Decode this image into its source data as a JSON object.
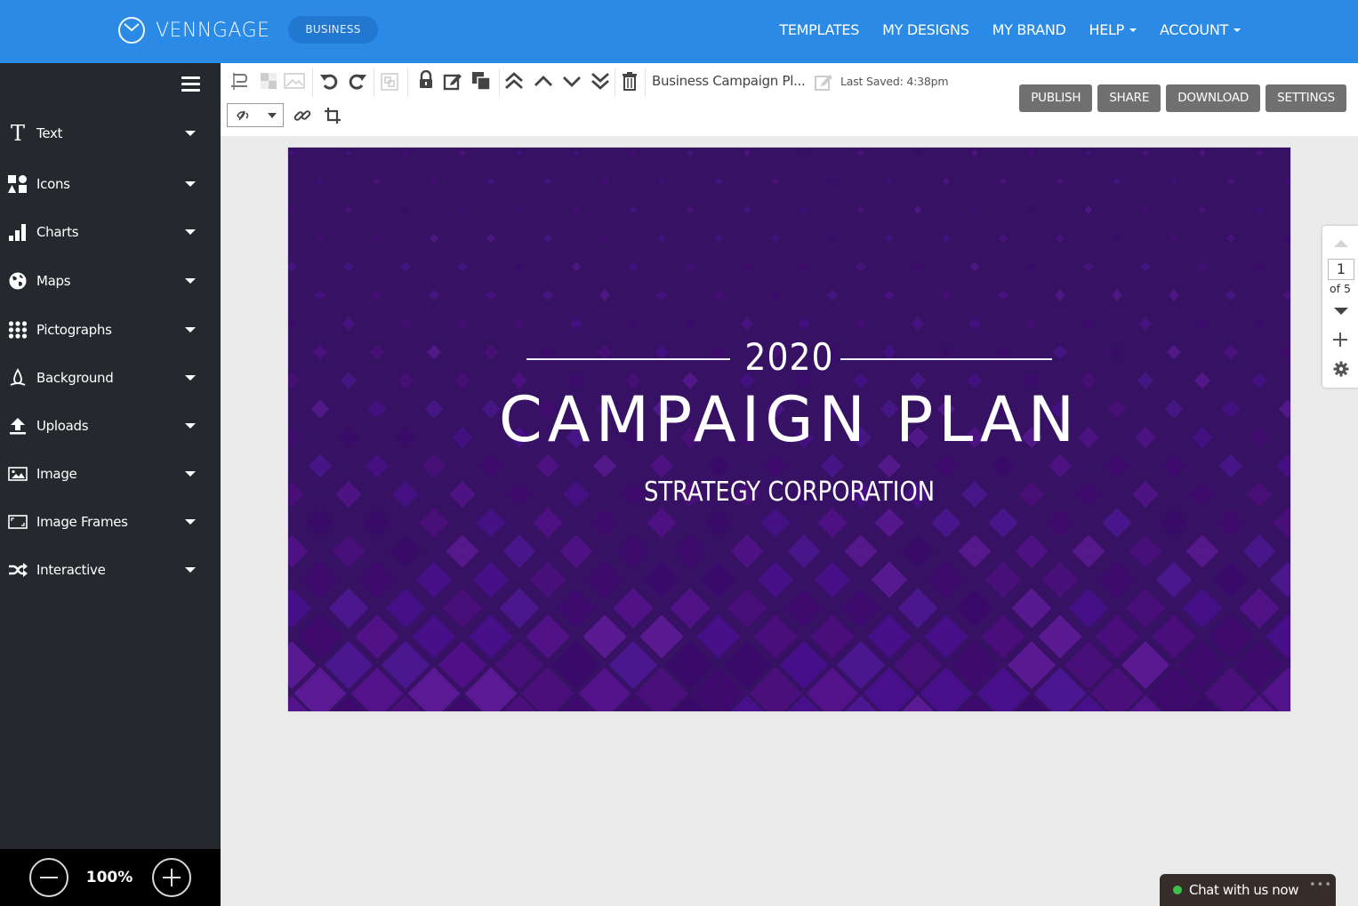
{
  "topnav": {
    "brand": "VENNGAGE",
    "plan_badge": "BUSINESS",
    "links": [
      {
        "label": "TEMPLATES",
        "has_dropdown": false
      },
      {
        "label": "MY DESIGNS",
        "has_dropdown": false
      },
      {
        "label": "MY BRAND",
        "has_dropdown": false
      },
      {
        "label": "HELP",
        "has_dropdown": true
      },
      {
        "label": "ACCOUNT",
        "has_dropdown": true
      }
    ],
    "color": "#2a8ae6"
  },
  "sidebar": {
    "menu_icon": "hamburger-icon",
    "items": [
      {
        "label": "Text",
        "icon": "text-icon"
      },
      {
        "label": "Icons",
        "icon": "shapes-icon"
      },
      {
        "label": "Charts",
        "icon": "bar-chart-icon"
      },
      {
        "label": "Maps",
        "icon": "globe-icon"
      },
      {
        "label": "Pictographs",
        "icon": "dot-grid-icon"
      },
      {
        "label": "Background",
        "icon": "droplet-icon"
      },
      {
        "label": "Uploads",
        "icon": "upload-icon"
      },
      {
        "label": "Image",
        "icon": "image-icon"
      },
      {
        "label": "Image Frames",
        "icon": "frame-icon"
      },
      {
        "label": "Interactive",
        "icon": "shuffle-icon"
      }
    ],
    "zoom": {
      "value": "100%",
      "minus_icon": "zoom-out-icon",
      "plus_icon": "zoom-in-icon"
    }
  },
  "toolbar": {
    "icons": [
      "text-align-icon",
      "transparency-icon",
      "replace-image-icon",
      "undo-icon",
      "redo-icon",
      "group-icon",
      "lock-icon",
      "edit-icon",
      "duplicate-icon",
      "bring-to-front-icon",
      "bring-forward-icon",
      "send-backward-icon",
      "send-to-back-icon",
      "delete-icon"
    ],
    "document_title": "Business Campaign Pl...",
    "rename_icon": "rename-icon",
    "last_saved": "Last Saved: 4:38pm",
    "actions": [
      "PUBLISH",
      "SHARE",
      "DOWNLOAD",
      "SETTINGS"
    ],
    "visibility_select": "visibility-icon",
    "link_icon": "link-icon",
    "crop_icon": "crop-icon"
  },
  "canvas": {
    "year": "2020",
    "title": "CAMPAIGN PLAN",
    "subtitle": "STRATEGY CORPORATION",
    "background_color": "#371264",
    "pattern_colors": [
      "#4a0f7a",
      "#521289",
      "#3f0a6e",
      "#47108a",
      "#5a1a93",
      "#3a0a6a",
      "#4b1790"
    ]
  },
  "pager": {
    "current": "1",
    "total_label": "of 5"
  },
  "chat": {
    "label": "Chat with us now",
    "more": "•••",
    "status_color": "#3cc04a"
  }
}
